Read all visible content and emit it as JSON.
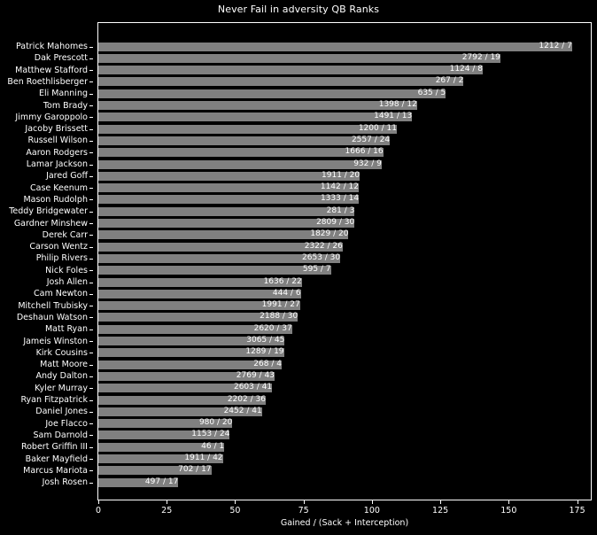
{
  "chart_data": {
    "type": "bar",
    "orientation": "horizontal",
    "title": "Never Fail in adversity QB Ranks",
    "xlabel": "Gained / (Sack + Interception)",
    "ylabel": "",
    "xlim": [
      0,
      180
    ],
    "xticks": [
      0,
      25,
      50,
      75,
      100,
      125,
      150,
      175
    ],
    "grid": false,
    "legend": null,
    "bar_color": "#808080",
    "background_color": "#000000",
    "text_color": "#ffffff",
    "categories": [
      "Patrick Mahomes",
      "Dak Prescott",
      "Matthew Stafford",
      "Ben Roethlisberger",
      "Eli Manning",
      "Tom Brady",
      "Jimmy Garoppolo",
      "Jacoby Brissett",
      "Russell Wilson",
      "Aaron Rodgers",
      "Lamar Jackson",
      "Jared Goff",
      "Case Keenum",
      "Mason Rudolph",
      "Teddy Bridgewater",
      "Gardner Minshew",
      "Derek Carr",
      "Carson Wentz",
      "Philip Rivers",
      "Nick Foles",
      "Josh Allen",
      "Cam Newton",
      "Mitchell Trubisky",
      "Deshaun Watson",
      "Matt Ryan",
      "Jameis Winston",
      "Kirk Cousins",
      "Matt Moore",
      "Andy Dalton",
      "Kyler Murray",
      "Ryan Fitzpatrick",
      "Daniel Jones",
      "Joe Flacco",
      "Sam Darnold",
      "Robert Griffin III",
      "Baker Mayfield",
      "Marcus Mariota",
      "Josh Rosen"
    ],
    "values": [
      173.14,
      146.95,
      140.5,
      133.5,
      127.0,
      116.5,
      114.69,
      109.09,
      106.54,
      104.13,
      103.56,
      95.55,
      95.17,
      95.21,
      93.67,
      93.63,
      91.45,
      89.31,
      88.43,
      85.0,
      74.36,
      74.0,
      73.74,
      72.93,
      70.81,
      68.11,
      67.84,
      67.0,
      64.4,
      63.49,
      61.17,
      59.8,
      49.0,
      48.04,
      46.0,
      45.5,
      41.29,
      29.24
    ],
    "bar_labels": [
      "1212 / 7",
      "2792 / 19",
      "1124 / 8",
      "267 / 2",
      "635 / 5",
      "1398 / 12",
      "1491 / 13",
      "1200 / 11",
      "2557 / 24",
      "1666 / 16",
      "932 / 9",
      "1911 / 20",
      "1142 / 12",
      "1333 / 14",
      "281 / 3",
      "2809 / 30",
      "1829 / 20",
      "2322 / 26",
      "2653 / 30",
      "595 / 7",
      "1636 / 22",
      "444 / 6",
      "1991 / 27",
      "2188 / 30",
      "2620 / 37",
      "3065 / 45",
      "1289 / 19",
      "268 / 4",
      "2769 / 43",
      "2603 / 41",
      "2202 / 36",
      "2452 / 41",
      "980 / 20",
      "1153 / 24",
      "46 / 1",
      "1911 / 42",
      "702 / 17",
      "497 / 17"
    ]
  }
}
